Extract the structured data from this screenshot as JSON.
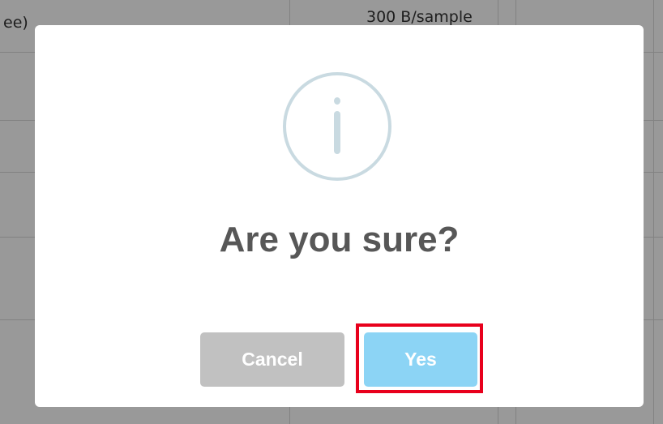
{
  "background": {
    "left_cell_text": "ee)",
    "right_cell_text": "300 B/sample"
  },
  "dialog": {
    "icon": "info-icon",
    "title": "Are you sure?",
    "cancel_label": "Cancel",
    "confirm_label": "Yes"
  },
  "colors": {
    "overlay": "rgba(0,0,0,0.40)",
    "icon": "#c9dae1",
    "title": "#575757",
    "cancel_button": "#c1c1c1",
    "confirm_button": "#8cd4f5",
    "highlight": "#e8001c"
  }
}
